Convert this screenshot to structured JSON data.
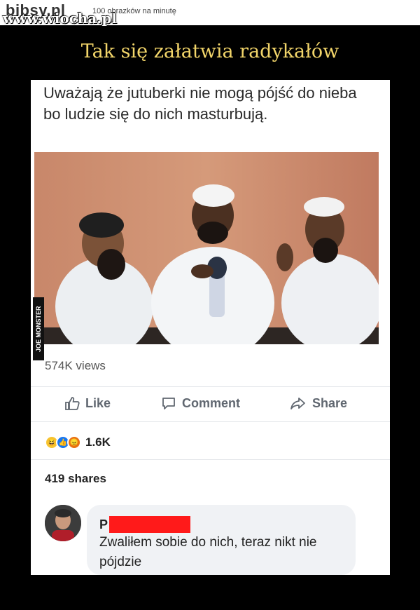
{
  "header": {
    "logo": "bibsy.pl",
    "sublogo": "www.wiocha.pl",
    "tagline": "100 obrazków na minutę"
  },
  "meme": {
    "title": "Tak się załatwia radykałów"
  },
  "post": {
    "text": "Uważają że jutuberki nie mogą pójść do nieba bo ludzie się do nich masturbują.",
    "watermark": "JOE MONSTER",
    "views": "574K views",
    "actions": {
      "like": "Like",
      "comment": "Comment",
      "share": "Share"
    },
    "reactions": {
      "icons": [
        "haha-icon",
        "like-icon",
        "angry-icon"
      ],
      "count": "1.6K"
    },
    "shares": "419 shares"
  },
  "comment": {
    "author_initial": "P",
    "text": "Zwaliłem sobie do nich, teraz nikt nie pójdzie",
    "redaction_color": "#ff1a1a"
  },
  "colors": {
    "title": "#f2d56a",
    "background": "#000000",
    "fb_gray": "#606770"
  }
}
